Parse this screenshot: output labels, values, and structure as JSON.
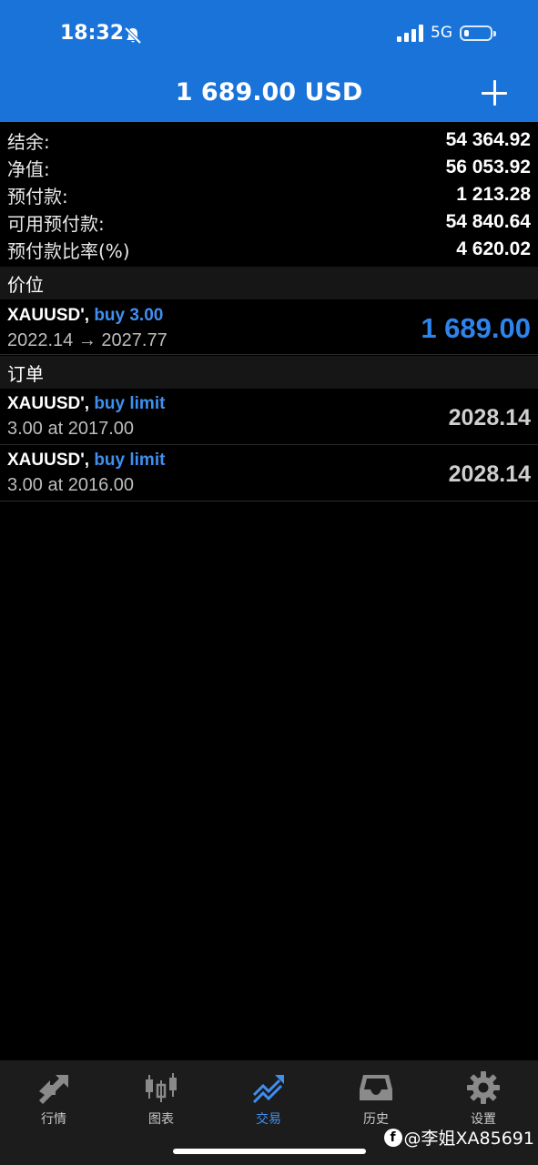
{
  "status": {
    "time": "18:32",
    "network": "5G"
  },
  "header": {
    "title": "1 689.00 USD"
  },
  "summary": [
    {
      "label": "结余:",
      "value": "54 364.92"
    },
    {
      "label": "净值:",
      "value": "56 053.92"
    },
    {
      "label": "预付款:",
      "value": "1 213.28"
    },
    {
      "label": "可用预付款:",
      "value": "54 840.64"
    },
    {
      "label": "预付款比率(%)",
      "value": "4 620.02"
    }
  ],
  "positions_section": {
    "title": "价位"
  },
  "position": {
    "symbol": "XAUUSD',",
    "side": "buy 3.00",
    "prices": "2022.14 → 2027.77",
    "profit": "1 689.00"
  },
  "orders_section": {
    "title": "订单"
  },
  "orders": [
    {
      "symbol": "XAUUSD',",
      "side": "buy limit",
      "detail": "3.00 at 2017.00",
      "price": "2028.14"
    },
    {
      "symbol": "XAUUSD',",
      "side": "buy limit",
      "detail": "3.00 at 2016.00",
      "price": "2028.14"
    }
  ],
  "tabs": [
    {
      "label": "行情",
      "icon": "quotes-icon"
    },
    {
      "label": "图表",
      "icon": "chart-icon"
    },
    {
      "label": "交易",
      "icon": "trade-icon",
      "active": true
    },
    {
      "label": "历史",
      "icon": "history-icon"
    },
    {
      "label": "设置",
      "icon": "settings-icon"
    }
  ],
  "watermark": {
    "text": "@李姐XA85691"
  },
  "colors": {
    "accent": "#1a73d9",
    "link": "#3f8ff0",
    "background": "#000000"
  }
}
